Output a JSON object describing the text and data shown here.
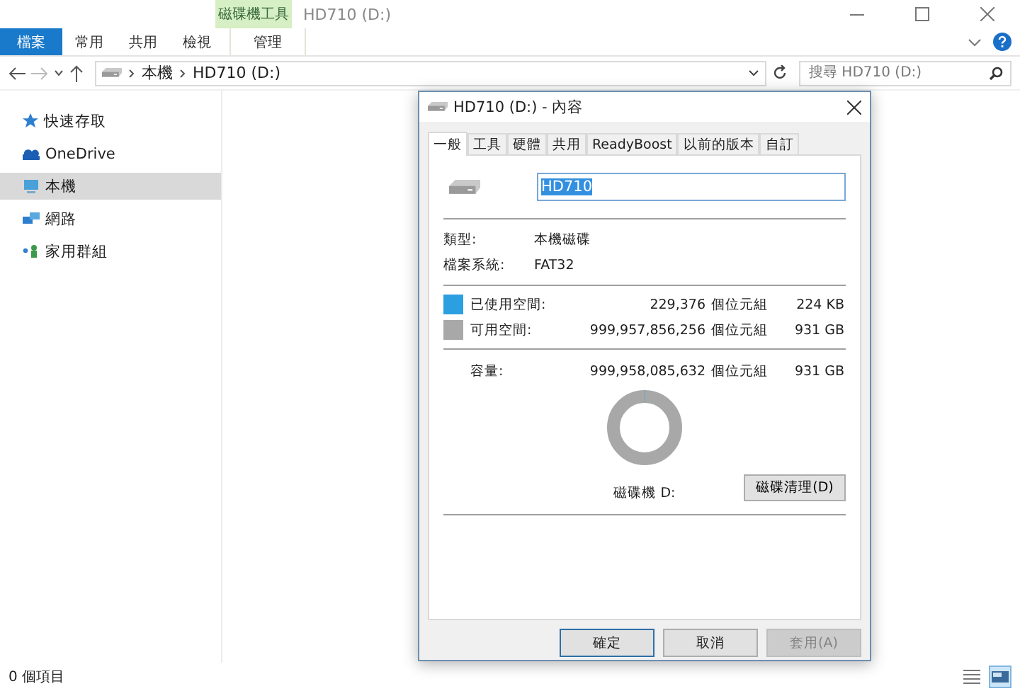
{
  "window": {
    "contextual_group": "磁碟機工具",
    "title": "HD710 (D:)"
  },
  "ribbon_tabs": [
    {
      "label": "檔案",
      "kind": "file"
    },
    {
      "label": "常用",
      "kind": "tab"
    },
    {
      "label": "共用",
      "kind": "tab"
    },
    {
      "label": "檢視",
      "kind": "tab"
    },
    {
      "label": "管理",
      "kind": "contextual"
    }
  ],
  "address": {
    "path": [
      "本機",
      "HD710 (D:)"
    ]
  },
  "search": {
    "placeholder": "搜尋 HD710 (D:)"
  },
  "nav_items": [
    {
      "label": "快速存取",
      "kind": "quick",
      "selected": false
    },
    {
      "label": "OneDrive",
      "kind": "cloud",
      "selected": false
    },
    {
      "label": "本機",
      "kind": "pc",
      "selected": true
    },
    {
      "label": "網路",
      "kind": "network",
      "selected": false
    },
    {
      "label": "家用群組",
      "kind": "homegroup",
      "selected": false
    }
  ],
  "status_bar": {
    "text": "0 個項目"
  },
  "view_buttons": [
    {
      "kind": "details",
      "selected": false
    },
    {
      "kind": "tiles",
      "selected": true
    }
  ],
  "dialog": {
    "title": "HD710 (D:) - 內容",
    "tabs": [
      {
        "label": "一般",
        "selected": true
      },
      {
        "label": "工具",
        "selected": false
      },
      {
        "label": "硬體",
        "selected": false
      },
      {
        "label": "共用",
        "selected": false
      },
      {
        "label": "ReadyBoost",
        "selected": false
      },
      {
        "label": "以前的版本",
        "selected": false
      },
      {
        "label": "自訂",
        "selected": false
      }
    ],
    "name_value": "HD710",
    "info": [
      {
        "label": "類型:",
        "value": "本機磁碟"
      },
      {
        "label": "檔案系統:",
        "value": "FAT32"
      }
    ],
    "space": [
      {
        "label": "已使用空間:",
        "bytes": "229,376",
        "unit": "個位元組",
        "size": "224 KB",
        "color": "#2c9fe0"
      },
      {
        "label": "可用空間:",
        "bytes": "999,957,856,256",
        "unit": "個位元組",
        "size": "931 GB",
        "color": "#a8a8a8"
      }
    ],
    "capacity": {
      "label": "容量:",
      "bytes": "999,958,085,632",
      "unit": "個位元組",
      "size": "931 GB"
    },
    "drive_label": "磁碟機 D:",
    "cleanup_button": "磁碟清理(D)",
    "buttons": [
      {
        "label": "確定",
        "kind": "default",
        "disabled": false
      },
      {
        "label": "取消",
        "kind": "normal",
        "disabled": false
      },
      {
        "label": "套用(A)",
        "kind": "normal",
        "disabled": true
      }
    ]
  }
}
